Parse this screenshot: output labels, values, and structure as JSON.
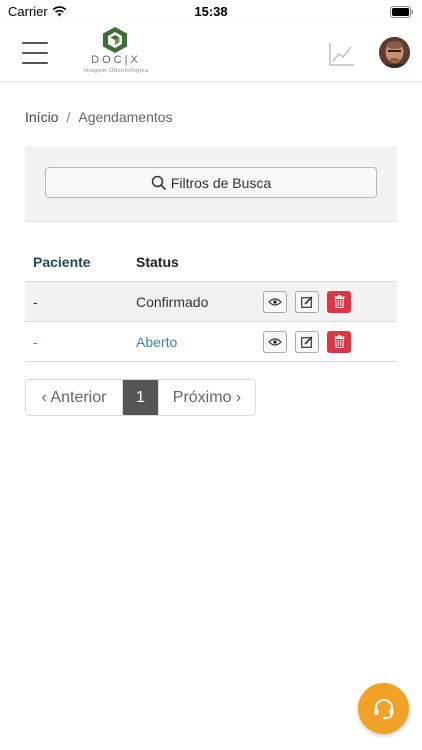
{
  "status_bar": {
    "carrier": "Carrier",
    "time": "15:38"
  },
  "header": {
    "logo_text": "DOC|X",
    "logo_subtitle": "Imagem Odontológica"
  },
  "breadcrumb": {
    "home": "Início",
    "separator": "/",
    "current": "Agendamentos"
  },
  "filters": {
    "button_label": "Filtros de Busca"
  },
  "table": {
    "columns": [
      "Paciente",
      "Status"
    ],
    "rows": [
      {
        "paciente": "-",
        "status": "Confirmado"
      },
      {
        "paciente": "-",
        "status": "Aberto"
      }
    ]
  },
  "pagination": {
    "prev_label": "‹ Anterior",
    "current_page": "1",
    "next_label": "Próximo ›"
  },
  "colors": {
    "accent_link": "#3b86a8",
    "header_text": "#1f4a5c",
    "danger": "#dc3545",
    "fab": "#f0a126",
    "logo_green": "#3e6e33"
  },
  "icons": {
    "menu": "hamburger-icon",
    "stats": "line-chart-icon",
    "search": "search-icon",
    "view": "eye-icon",
    "edit": "edit-icon",
    "delete": "trash-icon",
    "support": "headset-icon"
  }
}
